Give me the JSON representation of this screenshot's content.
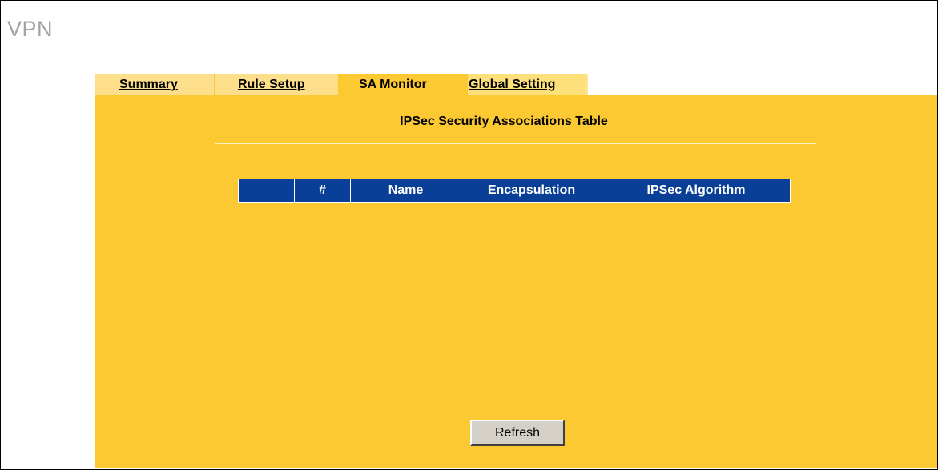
{
  "page": {
    "title": "VPN"
  },
  "tabs": [
    {
      "label": "Summary",
      "active": false
    },
    {
      "label": "Rule Setup",
      "active": false
    },
    {
      "label": "SA Monitor",
      "active": true
    },
    {
      "label": "Global Setting",
      "active": false
    }
  ],
  "sa_table": {
    "title": "IPSec Security Associations Table",
    "columns": [
      "",
      "#",
      "Name",
      "Encapsulation",
      "IPSec Algorithm"
    ],
    "rows": []
  },
  "actions": {
    "refresh_label": "Refresh"
  },
  "colors": {
    "panel": "#fdc932",
    "tab_inactive": "#fddf8b",
    "table_header": "#0a3f98",
    "title_text": "#a3a3a3"
  }
}
